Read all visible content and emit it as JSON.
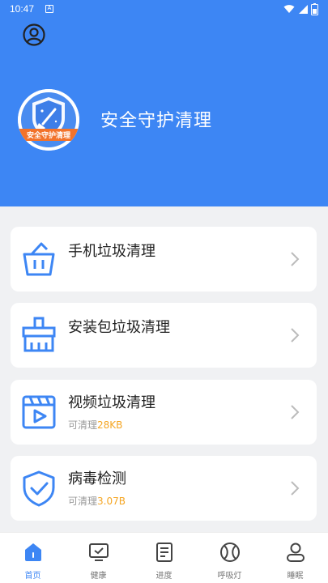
{
  "status_bar": {
    "time": "10:47",
    "notif_glyph": "A"
  },
  "header": {
    "app_name": "安全守护清理",
    "logo_text": "安全守护清理",
    "profile_icon": "user-circle-icon"
  },
  "cards": [
    {
      "title": "手机垃圾清理",
      "icon": "trash-basket-icon"
    },
    {
      "title": "安装包垃圾清理",
      "icon": "broom-icon"
    },
    {
      "title": "视频垃圾清理",
      "icon": "video-clapper-icon",
      "sub_prefix": "可清理",
      "sub_amount": "28KB"
    },
    {
      "title": "病毒检测",
      "icon": "shield-check-icon",
      "sub_prefix": "可清理",
      "sub_amount": "3.07B"
    }
  ],
  "tabs": [
    {
      "label": "首页",
      "icon": "home-icon",
      "active": true
    },
    {
      "label": "健康",
      "icon": "monitor-check-icon"
    },
    {
      "label": "进度",
      "icon": "document-icon"
    },
    {
      "label": "呼吸灯",
      "icon": "ball-icon"
    },
    {
      "label": "睡眠",
      "icon": "person-icon"
    }
  ],
  "colors": {
    "primary": "#3d86f4",
    "accent": "#f5a623",
    "background": "#f0f1f3"
  }
}
